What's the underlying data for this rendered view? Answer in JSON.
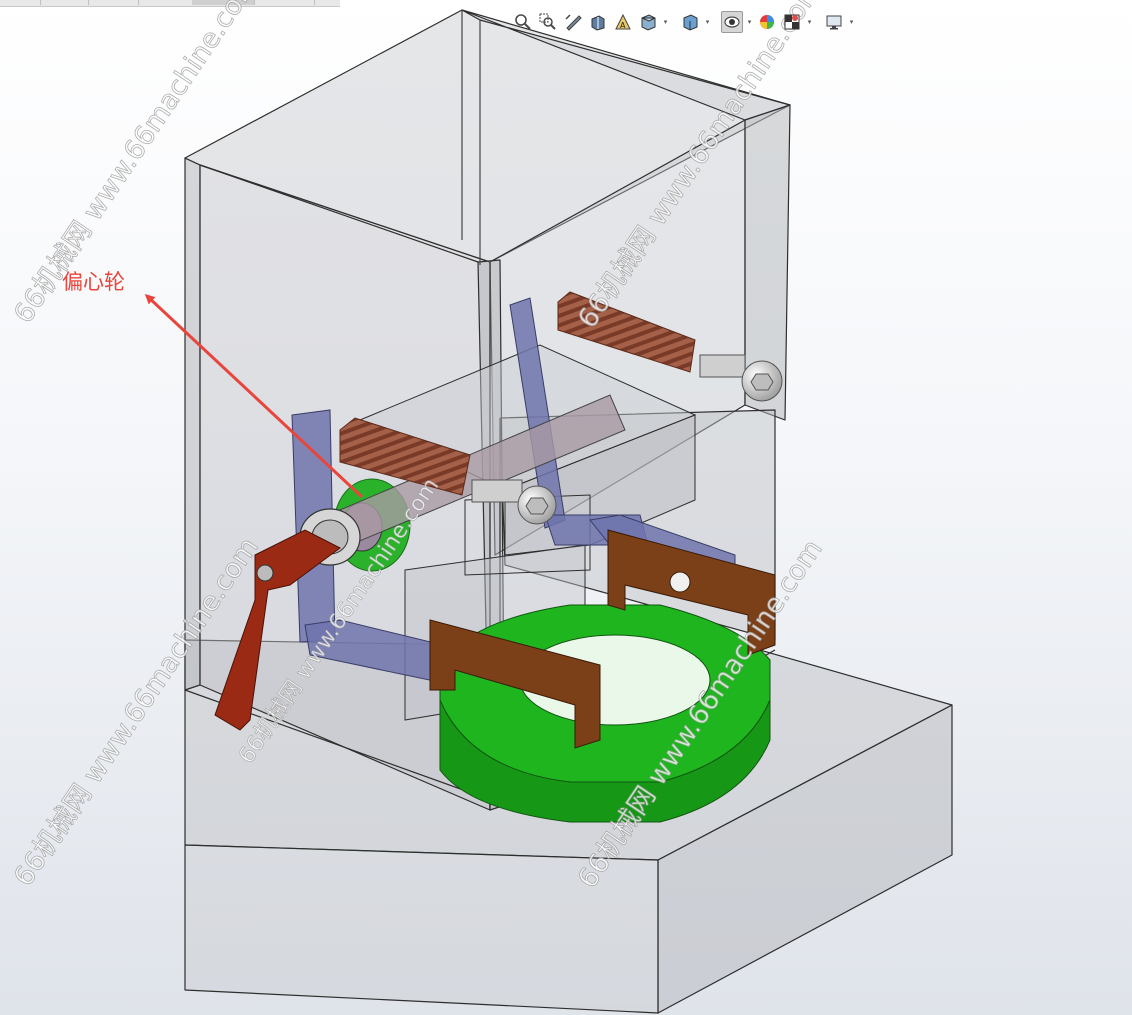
{
  "callout": {
    "label": "偏心轮"
  },
  "watermarks": [
    {
      "text": "66机械网 www.66machine.com"
    },
    {
      "text": "66机械网 www.66machine.com"
    },
    {
      "text": "66机械网 www.66machine.com"
    },
    {
      "text": "66机械网 www.66machine.com"
    },
    {
      "text": "66机械网 www.66machine.com"
    }
  ],
  "toolbar": {
    "buttons": [
      {
        "name": "zoom-to-fit-icon"
      },
      {
        "name": "zoom-to-area-icon"
      },
      {
        "name": "previous-view-icon"
      },
      {
        "name": "section-view-icon"
      },
      {
        "name": "dynamic-annotation-icon"
      },
      {
        "name": "view-orientation-icon",
        "dropdown": true
      },
      {
        "name": "display-style-icon",
        "dropdown": true
      },
      {
        "name": "hide-show-items-icon",
        "dropdown": true,
        "active": true
      },
      {
        "name": "edit-appearance-icon"
      },
      {
        "name": "apply-scene-icon",
        "dropdown": true
      },
      {
        "name": "view-settings-icon",
        "dropdown": true
      }
    ]
  },
  "colors": {
    "callout": "#e8453c",
    "housing_fill": "#c6c8cd",
    "housing_edge": "#2e2e2e",
    "eccentric_wheel": "#2bb22b",
    "springs": "#9a5a45",
    "lever_handle": "#9a2a14",
    "link_arms": "#6f74ad",
    "jaws": "#7b4018",
    "base_ring": "#1fb51f",
    "screws": "#cfcfcf"
  }
}
